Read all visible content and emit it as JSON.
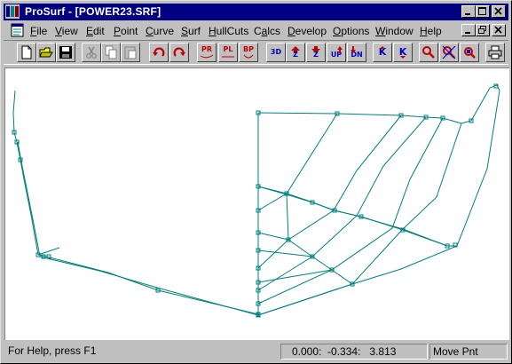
{
  "window": {
    "title": "ProSurf - [POWER23.SRF]"
  },
  "menu": {
    "items": [
      "File",
      "View",
      "Edit",
      "Point",
      "Curve",
      "Surf",
      "HullCuts",
      "Calcs",
      "Develop",
      "Options",
      "Window",
      "Help"
    ],
    "mnemonics": [
      "F",
      "V",
      "E",
      "P",
      "C",
      "S",
      "H",
      "a",
      "D",
      "O",
      "W",
      "H"
    ]
  },
  "toolbar": {
    "buttons": [
      {
        "name": "new-file-button",
        "label": ""
      },
      {
        "name": "open-file-button",
        "label": ""
      },
      {
        "name": "save-file-button",
        "label": ""
      },
      {
        "name": "cut-button",
        "label": ""
      },
      {
        "name": "copy-button",
        "label": ""
      },
      {
        "name": "paste-button",
        "label": ""
      },
      {
        "name": "undo-button",
        "label": ""
      },
      {
        "name": "redo-button",
        "label": ""
      },
      {
        "name": "profile-view-button",
        "label": "PR"
      },
      {
        "name": "plan-view-button",
        "label": "PL"
      },
      {
        "name": "body-plan-view-button",
        "label": "BP"
      },
      {
        "name": "3d-view-button",
        "label": "3D"
      },
      {
        "name": "zoom-in-button",
        "label": "Z"
      },
      {
        "name": "zoom-out-button",
        "label": "Z"
      },
      {
        "name": "pan-up-button",
        "label": "UP"
      },
      {
        "name": "pan-down-button",
        "label": "DN"
      },
      {
        "name": "knuckle-up-button",
        "label": "K"
      },
      {
        "name": "knuckle-down-button",
        "label": "K"
      },
      {
        "name": "magnify-button",
        "label": ""
      },
      {
        "name": "unmagnify-button",
        "label": ""
      },
      {
        "name": "zoom-fit-button",
        "label": ""
      },
      {
        "name": "print-button",
        "label": ""
      }
    ]
  },
  "status": {
    "help_text": "For Help, press F1",
    "coords": "0.000:  -0.334:   3.813",
    "mode": "Move Pnt"
  },
  "colors": {
    "titlebar": "#000080",
    "drawing_lines": "#007f7f",
    "chrome": "#c0c0c0"
  },
  "icons": {
    "app": "prosurf-app-icon",
    "doc": "document-icon",
    "minimize": "minimize-icon",
    "maximize": "maximize-icon",
    "close": "close-icon",
    "restore": "restore-icon"
  }
}
